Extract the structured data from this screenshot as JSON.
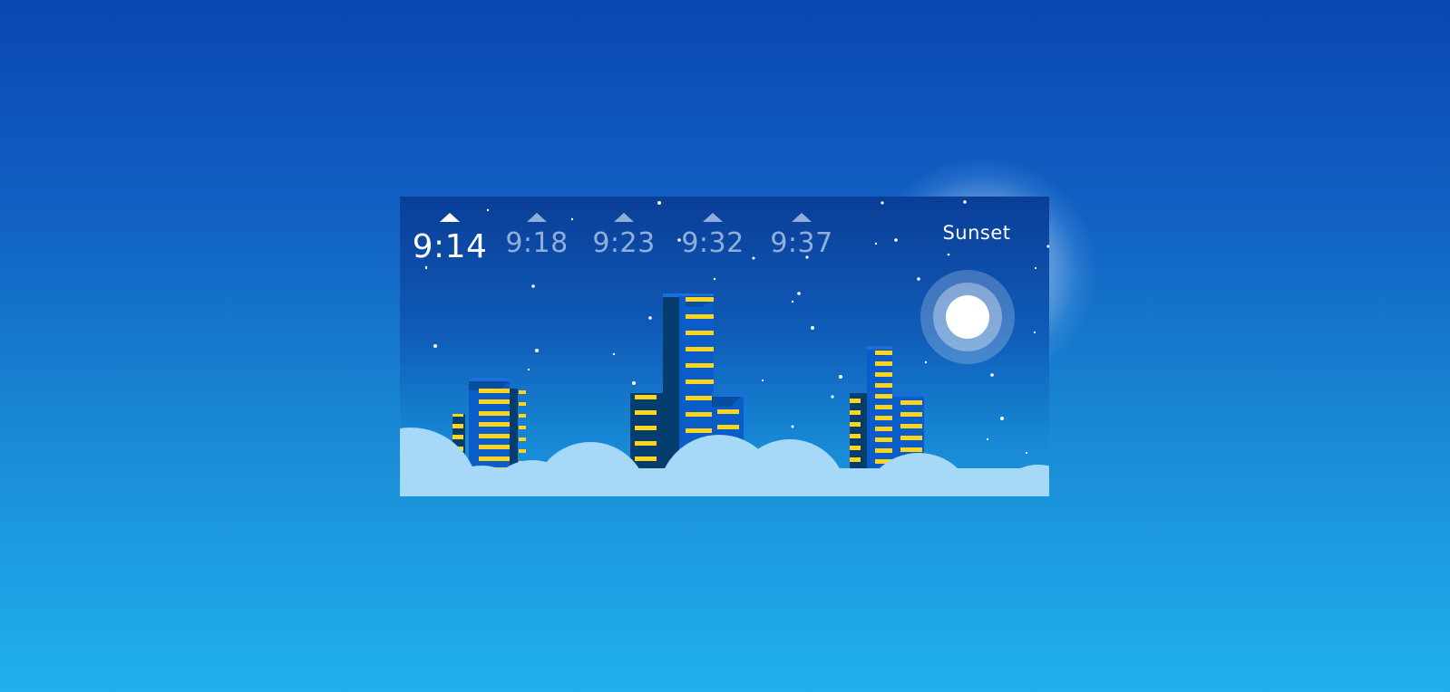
{
  "schedule": {
    "times": [
      {
        "label": "9:14",
        "active": true
      },
      {
        "label": "9:18",
        "active": false
      },
      {
        "label": "9:23",
        "active": false
      },
      {
        "label": "9:32",
        "active": false
      },
      {
        "label": "9:37",
        "active": false
      }
    ],
    "sunset_label": "Sunset"
  },
  "colors": {
    "window_light": "#ffd41c",
    "building_dark": "#053e6e",
    "building_mid": "#0a5cc9",
    "cloud": "#a6d8f7",
    "moon_core": "#ffffff"
  },
  "icons": {
    "selector": "triangle-up-icon",
    "celestial": "moon-icon"
  }
}
